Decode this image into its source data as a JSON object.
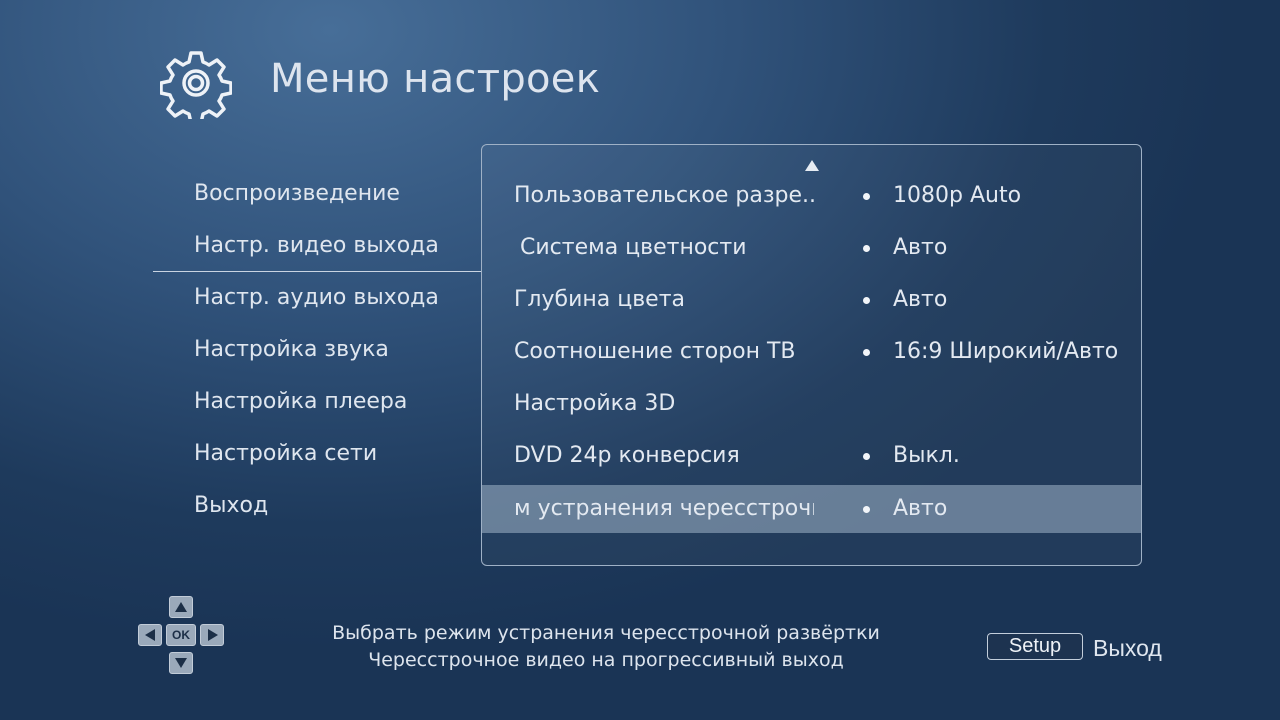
{
  "header": {
    "icon": "gear-icon",
    "title": "Меню настроек"
  },
  "left_menu": {
    "items": [
      {
        "label": "Воспроизведение"
      },
      {
        "label": "Настр. видео выхода",
        "active": true
      },
      {
        "label": "Настр. аудио выхода"
      },
      {
        "label": "Настройка звука"
      },
      {
        "label": "Настройка плеера"
      },
      {
        "label": "Настройка сети"
      },
      {
        "label": "Выход"
      }
    ]
  },
  "settings": {
    "rows": [
      {
        "label": "Пользовательское разре...",
        "value": "1080p Auto"
      },
      {
        "label": "Система цветности",
        "value": "Авто"
      },
      {
        "label": "Глубина цвета",
        "value": "Авто"
      },
      {
        "label": "Соотношение сторон ТВ",
        "value": "16:9 Широкий/Авто"
      },
      {
        "label": "Настройка 3D",
        "value": ""
      },
      {
        "label": "DVD 24p конверсия",
        "value": "Выкл."
      },
      {
        "label": "м устранения чересстрочн",
        "value": "Авто",
        "selected": true
      }
    ]
  },
  "footer": {
    "ok_label": "OK",
    "help_line1": "Выбрать режим устранения чересстрочной развёртки",
    "help_line2": "Чересстрочное видео на прогрессивный выход",
    "setup_button": "Setup",
    "setup_action": "Выход"
  },
  "colors": {
    "background_top": "#476e98",
    "background_bottom": "#1a3455",
    "selected_row": "#7d93a8",
    "text": "#e3e9f1"
  }
}
